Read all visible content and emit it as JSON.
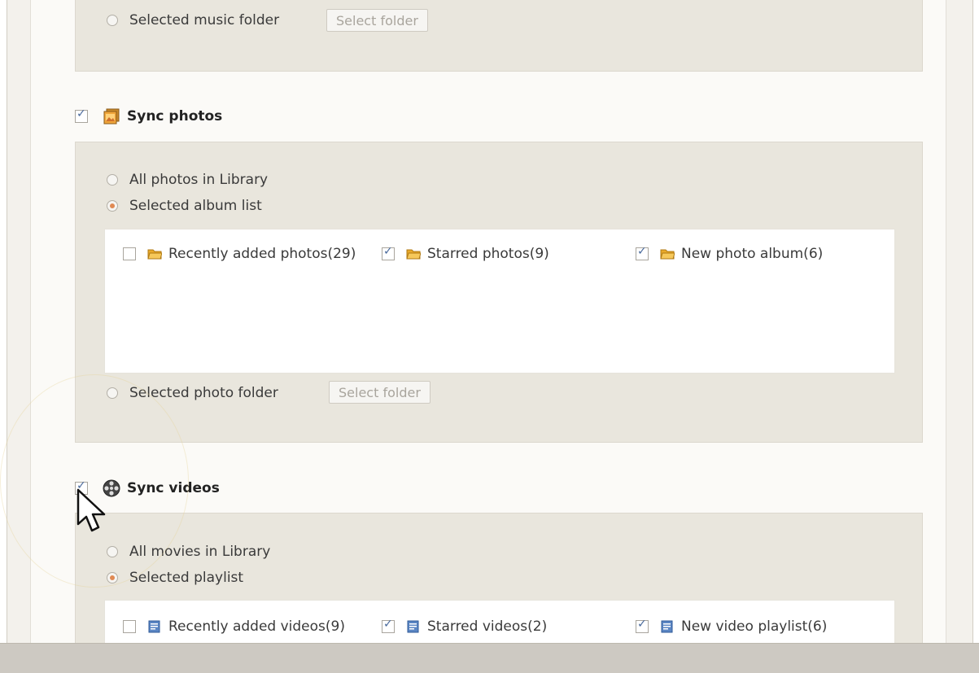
{
  "music": {
    "selected_folder_label": "Selected music folder",
    "select_folder_button": "Select folder"
  },
  "photos": {
    "section_title": "Sync photos",
    "section_checked": true,
    "options": {
      "all_label": "All photos in Library",
      "album_label": "Selected album list",
      "folder_label": "Selected photo folder"
    },
    "selected_option": "album",
    "albums": [
      {
        "label": "Recently added photos(29)",
        "checked": false
      },
      {
        "label": "Starred photos(9)",
        "checked": true
      },
      {
        "label": "New photo album(6)",
        "checked": true
      }
    ],
    "select_folder_button": "Select folder"
  },
  "videos": {
    "section_title": "Sync videos",
    "section_checked": true,
    "options": {
      "all_label": "All movies in Library",
      "playlist_label": "Selected playlist"
    },
    "selected_option": "playlist",
    "playlists": [
      {
        "label": "Recently added videos(9)",
        "checked": false
      },
      {
        "label": "Starred videos(2)",
        "checked": true
      },
      {
        "label": "New video playlist(6)",
        "checked": true
      }
    ]
  },
  "icons": {
    "photos": "photo-stack-icon",
    "videos": "film-reel-icon",
    "album": "folder-icon",
    "playlist": "playlist-icon",
    "cursor": "mouse-pointer-icon"
  },
  "colors": {
    "radio_selected": "#e08a54",
    "check_mark": "#4a6a9c",
    "panel_bg": "#e9e6dd"
  }
}
